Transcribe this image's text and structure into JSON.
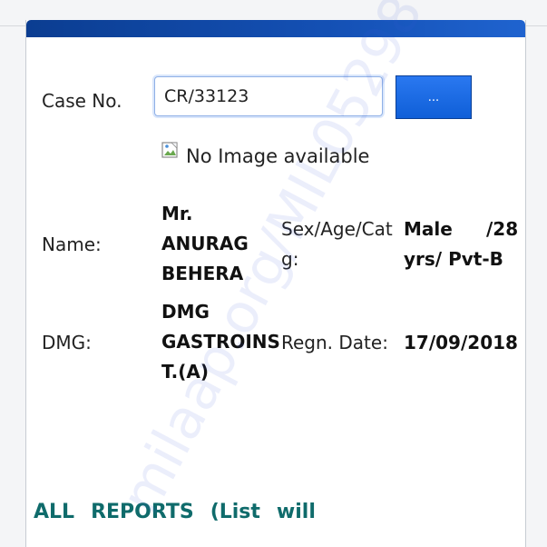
{
  "form": {
    "case_no_label": "Case No.",
    "case_no_value": "CR/33123",
    "lookup_button_label": "...",
    "no_image_text": "No Image available"
  },
  "details": {
    "name_label": "Name:",
    "name_value_line1": "Mr.",
    "name_value_line2": "ANURAG",
    "name_value_line3": "BEHERA",
    "sex_age_cat_label_line1": "Sex/Age/Cat",
    "sex_age_cat_label_line2": "g:",
    "sex_value_part1": "Male",
    "sex_value_part2": "/28",
    "sex_value_line2": "yrs/ Pvt-B",
    "dmg_label": "DMG:",
    "dmg_value_line1": "DMG",
    "dmg_value_line2": "GASTROINS",
    "dmg_value_line3": "T.(A)",
    "regn_date_label": "Regn. Date:",
    "regn_date_value": "17/09/2018"
  },
  "footer": {
    "links": [
      "ALL",
      "REPORTS",
      "(List",
      "will"
    ]
  },
  "watermark": {
    "text": "milaap.org/MIL05298"
  },
  "colors": {
    "header_bar": "#0b3d91",
    "lookup_button": "#1a66e0",
    "footer_link": "#0f6b6b"
  }
}
